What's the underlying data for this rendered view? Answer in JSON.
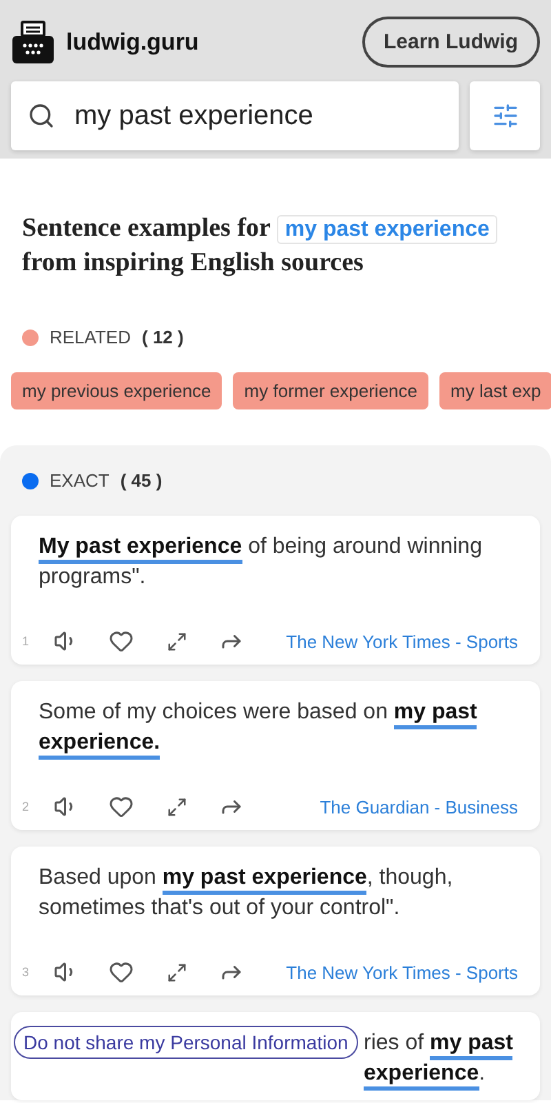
{
  "header": {
    "site": "ludwig.guru",
    "learn_button": "Learn Ludwig"
  },
  "search": {
    "value": "my past experience"
  },
  "heading": {
    "before": "Sentence examples for",
    "query": "my past experience",
    "after": "from inspiring English sources"
  },
  "related": {
    "label": "RELATED",
    "count": "( 12 )",
    "color": "#f4998a",
    "chips": [
      "my previous experience",
      "my former experience",
      "my last exp"
    ]
  },
  "exact": {
    "label": "EXACT",
    "count": "( 45 )",
    "color": "#0a6cf0"
  },
  "cards": [
    {
      "number": "1",
      "text": "**My past experience** of being around winning programs\".",
      "source": "The New York Times - Sports"
    },
    {
      "number": "2",
      "text": "Some of my choices were based on **my past experience.**",
      "source": "The Guardian - Business"
    },
    {
      "number": "3",
      "text": "Based upon **my past experience**, though, sometimes that's out of your control\".",
      "source": "The New York Times - Sports"
    },
    {
      "text": "ries of **my past experience**."
    }
  ],
  "privacy_link": "Do not share my Personal Information"
}
